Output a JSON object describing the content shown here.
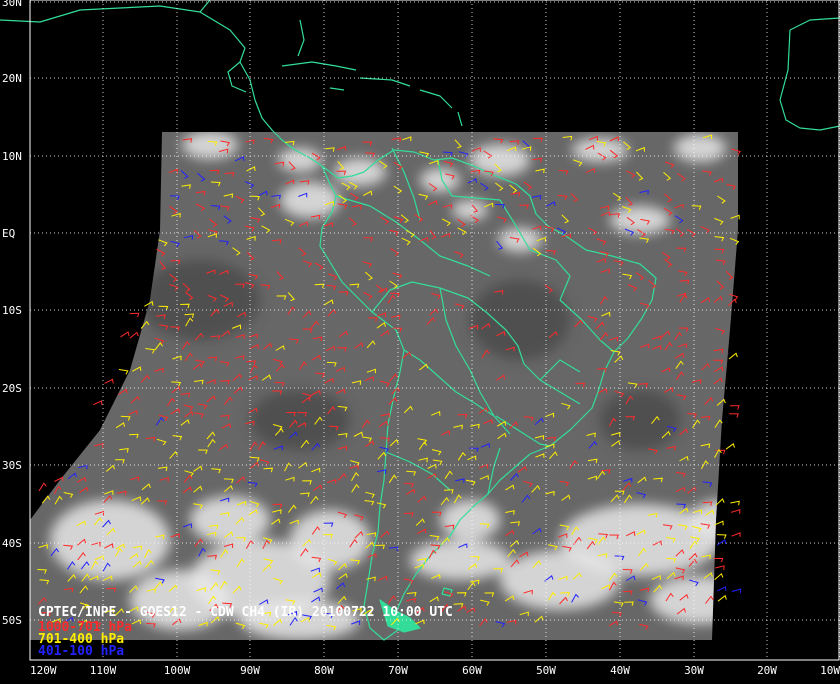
{
  "map": {
    "title": "CPTEC/INPE - GOES12 - CDW CH4 (IR) 20100722 10:00 UTC",
    "lat_labels": [
      "30N",
      "20N",
      "10N",
      "EQ",
      "10S",
      "20S",
      "30S",
      "40S",
      "50S"
    ],
    "lon_labels": [
      "120W",
      "110W",
      "100W",
      "90W",
      "80W",
      "70W",
      "60W",
      "50W",
      "40W",
      "30W",
      "20W",
      "10W"
    ],
    "legend": [
      {
        "label": "1000-701 hPa",
        "color": "#ff2a2a"
      },
      {
        "label": "701-400 hPa",
        "color": "#ffee00"
      },
      {
        "label": "401-100 hPa",
        "color": "#2222ff"
      }
    ],
    "colors": {
      "background": "#000000",
      "coastline": "#33dd99",
      "grid": "#ffffff",
      "satellite_gray": "#6a6a6a",
      "clouds": "#e8e8e8"
    }
  }
}
